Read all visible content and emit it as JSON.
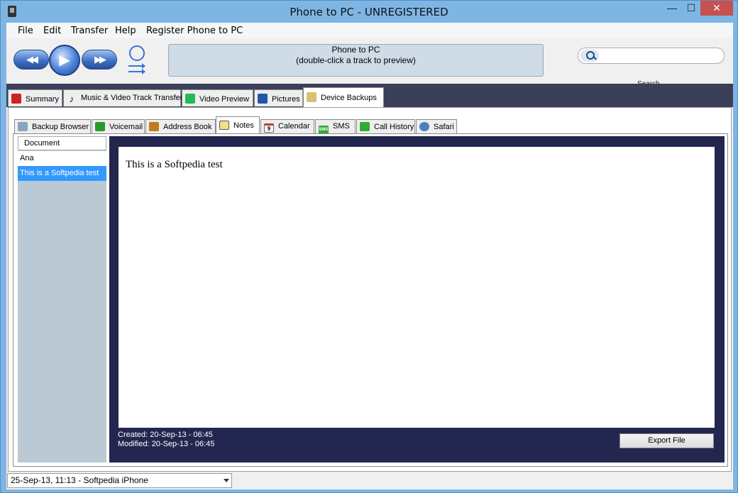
{
  "window": {
    "title": "Phone to PC - UNREGISTERED",
    "minimize": "—",
    "maximize": "☐",
    "close": "✕"
  },
  "menu": [
    "File",
    "Edit",
    "Transfer",
    "Help",
    "Register Phone to PC"
  ],
  "player": {
    "prev_icon": "◀◀",
    "play_icon": "▶",
    "next_icon": "▶▶",
    "display_line1": "Phone to PC",
    "display_line2": "(double-click a track to preview)"
  },
  "search": {
    "label": "Search",
    "value": "",
    "placeholder": ""
  },
  "main_tabs": [
    {
      "label": "Summary",
      "icon": "summary-icon",
      "color": "#cc2222"
    },
    {
      "label": "Music & Video Track Transfer",
      "icon": "music-note-icon",
      "color": "#111111"
    },
    {
      "label": "Video Preview",
      "icon": "film-icon",
      "color": "#22bb55"
    },
    {
      "label": "Pictures",
      "icon": "pictures-icon",
      "color": "#2255aa"
    },
    {
      "label": "Device Backups",
      "icon": "backup-folder-icon",
      "color": "#d8c070"
    }
  ],
  "sub_tabs": [
    {
      "label": "Backup Browser",
      "icon": "folder-icon",
      "color": "#8aa4c0"
    },
    {
      "label": "Voicemail",
      "icon": "voicemail-icon",
      "color": "#2a9a2a"
    },
    {
      "label": "Address Book",
      "icon": "address-book-icon",
      "color": "#c07a20"
    },
    {
      "label": "Notes",
      "icon": "notes-icon",
      "color": "#f0e08a"
    },
    {
      "label": "Calendar",
      "icon": "calendar-icon",
      "color": "#cc3333",
      "badge": "9"
    },
    {
      "label": "SMS",
      "icon": "sms-icon",
      "color": "#33aa33",
      "badge": "SMS"
    },
    {
      "label": "Call History",
      "icon": "phone-icon",
      "color": "#33aa33"
    },
    {
      "label": "Safari",
      "icon": "safari-icon",
      "color": "#4a7fc0"
    }
  ],
  "notes": {
    "column_header": "Document",
    "items": [
      "Ana",
      "This is a Softpedia test"
    ],
    "selected_index": 1,
    "content": "This is a Softpedia test",
    "created": "Created: 20-Sep-13 - 06:45",
    "modified": "Modified: 20-Sep-13 - 06:45",
    "export_label": "Export File"
  },
  "status": {
    "device": "25-Sep-13, 11:13 - Softpedia iPhone"
  }
}
